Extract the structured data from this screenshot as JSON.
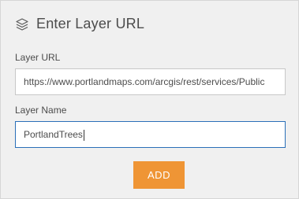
{
  "header": {
    "icon": "layers-icon",
    "title": "Enter Layer URL"
  },
  "layer_url": {
    "label": "Layer URL",
    "value": "https://www.portlandmaps.com/arcgis/rest/services/Public"
  },
  "layer_name": {
    "label": "Layer Name",
    "value": "PortlandTrees"
  },
  "actions": {
    "add_label": "ADD"
  },
  "colors": {
    "accent": "#ef9535",
    "focus_border": "#2a6fb8",
    "text": "#4c4c4c",
    "background": "#f0f0f0"
  }
}
